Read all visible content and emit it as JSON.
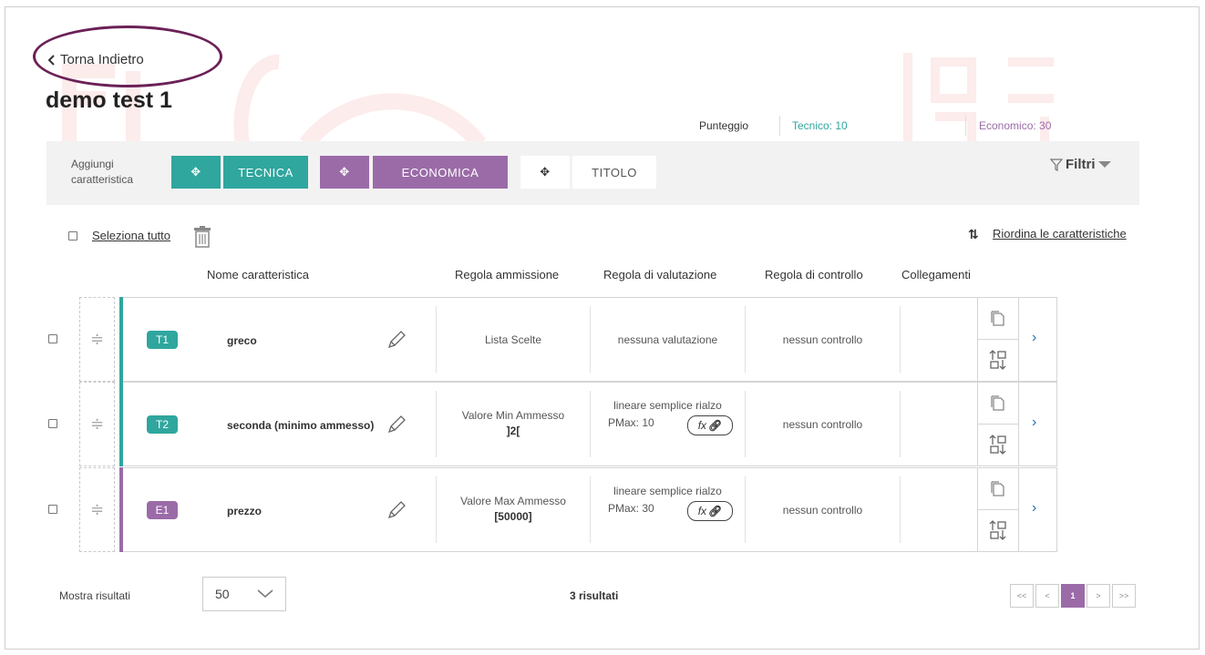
{
  "back": {
    "label": "Torna Indietro",
    "icon": "chevron-left-icon"
  },
  "page_title": "demo test 1",
  "score": {
    "label": "Punteggio",
    "tecnico": "Tecnico: 10",
    "economico": "Economico: 30",
    "tecnico_color": "#2fa69e",
    "economico_color": "#9b6ba8"
  },
  "toolbar": {
    "add_label_line1": "Aggiungi",
    "add_label_line2": "caratteristica",
    "tecnica": "TECNICA",
    "economica": "ECONOMICA",
    "titolo": "TITOLO",
    "filters": "Filtri"
  },
  "actions": {
    "select_all": "Seleziona tutto",
    "reorder": "Riordina le caratteristiche"
  },
  "columns": {
    "name": "Nome caratteristica",
    "admission": "Regola ammissione",
    "evaluation": "Regola di valutazione",
    "control": "Regola di controllo",
    "links": "Collegamenti"
  },
  "rows": [
    {
      "badge": "T1",
      "badge_color": "#2fa69e",
      "bar_color": "#2fa69e",
      "name": "greco",
      "admission_line1": "Lista Scelte",
      "admission_line2": "",
      "evaluation_line1": "nessuna valutazione",
      "evaluation_line2": "",
      "has_fx": false,
      "control": "nessun controllo"
    },
    {
      "badge": "T2",
      "badge_color": "#2fa69e",
      "bar_color": "#2fa69e",
      "name": "seconda (minimo ammesso)",
      "admission_line1": "Valore Min Ammesso",
      "admission_line2": "]2[",
      "evaluation_line1": "lineare semplice rialzo",
      "evaluation_line2": "PMax: 10",
      "has_fx": true,
      "control": "nessun controllo"
    },
    {
      "badge": "E1",
      "badge_color": "#9b6ba8",
      "bar_color": "#9b6ba8",
      "name": "prezzo",
      "admission_line1": "Valore Max Ammesso",
      "admission_line2": "[50000]",
      "evaluation_line1": "lineare semplice rialzo",
      "evaluation_line2": "PMax: 30",
      "has_fx": true,
      "control": "nessun controllo"
    }
  ],
  "fx_label": "fx",
  "footer": {
    "show_label": "Mostra risultati",
    "page_size": "50",
    "results": "3 risultati",
    "pagination": [
      "<<",
      "<",
      "1",
      ">",
      ">>"
    ],
    "active_page": "1"
  }
}
